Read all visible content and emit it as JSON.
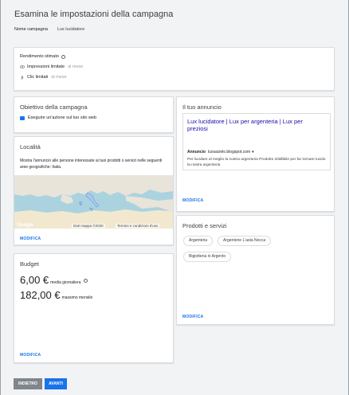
{
  "header": {
    "title": "Esamina le impostazioni della campagna",
    "campaign_name_label": "Nome campagna",
    "campaign_name_value": "Lux lucidatore"
  },
  "performance": {
    "estimated_label": "Rendimento stimato",
    "impressions_label": "Impressioni limitate",
    "impressions_suffix": "al mese",
    "clicks_label": "Clic limitati",
    "clicks_suffix": "al mese"
  },
  "goal": {
    "title": "Obiettivo della campagna",
    "value": "Eseguire un'azione sul tuo sito web"
  },
  "location": {
    "title": "Località",
    "description": "Mostra l'annuncio alle persone interessate ai tuoi prodotti o servizi nelle seguenti aree geografiche: Italia.",
    "map_logo": "Google",
    "map_data": "Dati mappa ©2020",
    "map_terms": "Termini e condizioni d'uso",
    "edit_label": "MODIFICA"
  },
  "budget": {
    "title": "Budget",
    "daily_value": "6,00 €",
    "daily_label": "media giornaliera",
    "monthly_value": "182,00 €",
    "monthly_label": "massimo mensile",
    "edit_label": "MODIFICA"
  },
  "ad": {
    "title": "Il tuo annuncio",
    "headline": "Lux lucidatore | Lux per argenteria | Lux per preziosi",
    "url_label": "Annuncio",
    "url": "luxsacielo.blogspot.com",
    "description": "Per lucidare al meglio la nostra argenteria Prodotto infallibile per far tornare lucido la nostra argenteria",
    "edit_label": "MODIFICA"
  },
  "products": {
    "title": "Prodotti e servizi",
    "chips": [
      "Argenteria",
      "Argenterie L'asta Nocca",
      "Bigiotteria in Argento"
    ],
    "edit_label": "MODIFICA"
  },
  "footer": {
    "back_label": "INDIETRO",
    "next_label": "AVANTI"
  },
  "colors": {
    "accent": "#1a73e8",
    "back_button": "#80868b",
    "background": "#f1f3f4"
  }
}
